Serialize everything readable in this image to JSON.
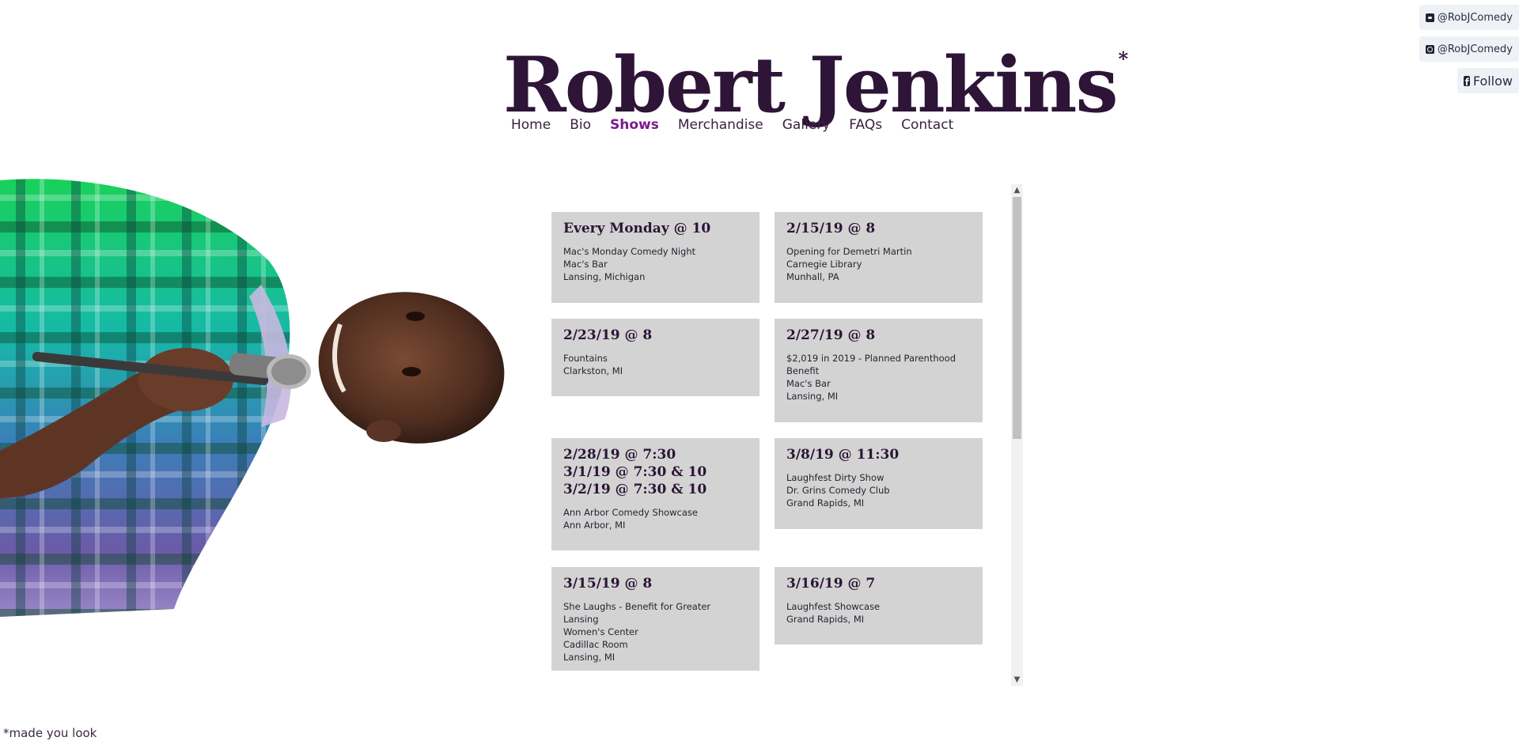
{
  "header": {
    "title": "Robert Jenkins",
    "title_mark": "*"
  },
  "nav": {
    "items": [
      {
        "label": "Home",
        "active": false
      },
      {
        "label": "Bio",
        "active": false
      },
      {
        "label": "Shows",
        "active": true
      },
      {
        "label": "Merchandise",
        "active": false
      },
      {
        "label": "Gallery",
        "active": false
      },
      {
        "label": "FAQs",
        "active": false
      },
      {
        "label": "Contact",
        "active": false
      }
    ]
  },
  "social": {
    "twitter": {
      "label": "@RobJComedy",
      "icon": "twitter-icon"
    },
    "instagram": {
      "label": "@RobJComedy",
      "icon": "instagram-icon"
    },
    "facebook": {
      "label": "Follow",
      "icon": "facebook-icon"
    }
  },
  "shows": [
    {
      "date": "Every Monday @ 10",
      "lines": [
        "Mac's Monday Comedy Night",
        "Mac's Bar",
        "Lansing, Michigan"
      ]
    },
    {
      "date": "2/15/19 @ 8",
      "lines": [
        "Opening for Demetri Martin",
        "Carnegie Library",
        "Munhall, PA"
      ]
    },
    {
      "date": "2/23/19 @ 8",
      "lines": [
        "Fountains",
        "Clarkston, MI"
      ]
    },
    {
      "date": "2/27/19 @ 8",
      "lines": [
        "$2,019 in 2019 - Planned Parenthood",
        "Benefit",
        "Mac's Bar",
        "Lansing, MI"
      ]
    },
    {
      "date": "2/28/19 @ 7:30\n3/1/19 @ 7:30 & 10\n3/2/19 @ 7:30 & 10",
      "lines": [
        "Ann Arbor Comedy Showcase",
        "Ann Arbor, MI"
      ]
    },
    {
      "date": "3/8/19 @ 11:30",
      "lines": [
        "Laughfest Dirty Show",
        "Dr. Grins Comedy Club",
        "Grand Rapids, MI"
      ]
    },
    {
      "date": "3/15/19 @ 8",
      "lines": [
        "She Laughs - Benefit for Greater Lansing",
        "Women's Center",
        "Cadillac Room",
        "Lansing, MI"
      ]
    },
    {
      "date": "3/16/19 @ 7",
      "lines": [
        "Laughfest Showcase",
        "Grand Rapids, MI"
      ]
    }
  ],
  "scrollbar": {
    "up": "▲",
    "down": "▼"
  },
  "footer": {
    "note": "*made you look"
  },
  "colors": {
    "title": "#2e1437",
    "nav_active": "#7a1b8c",
    "card_bg": "#d3d3d3"
  }
}
